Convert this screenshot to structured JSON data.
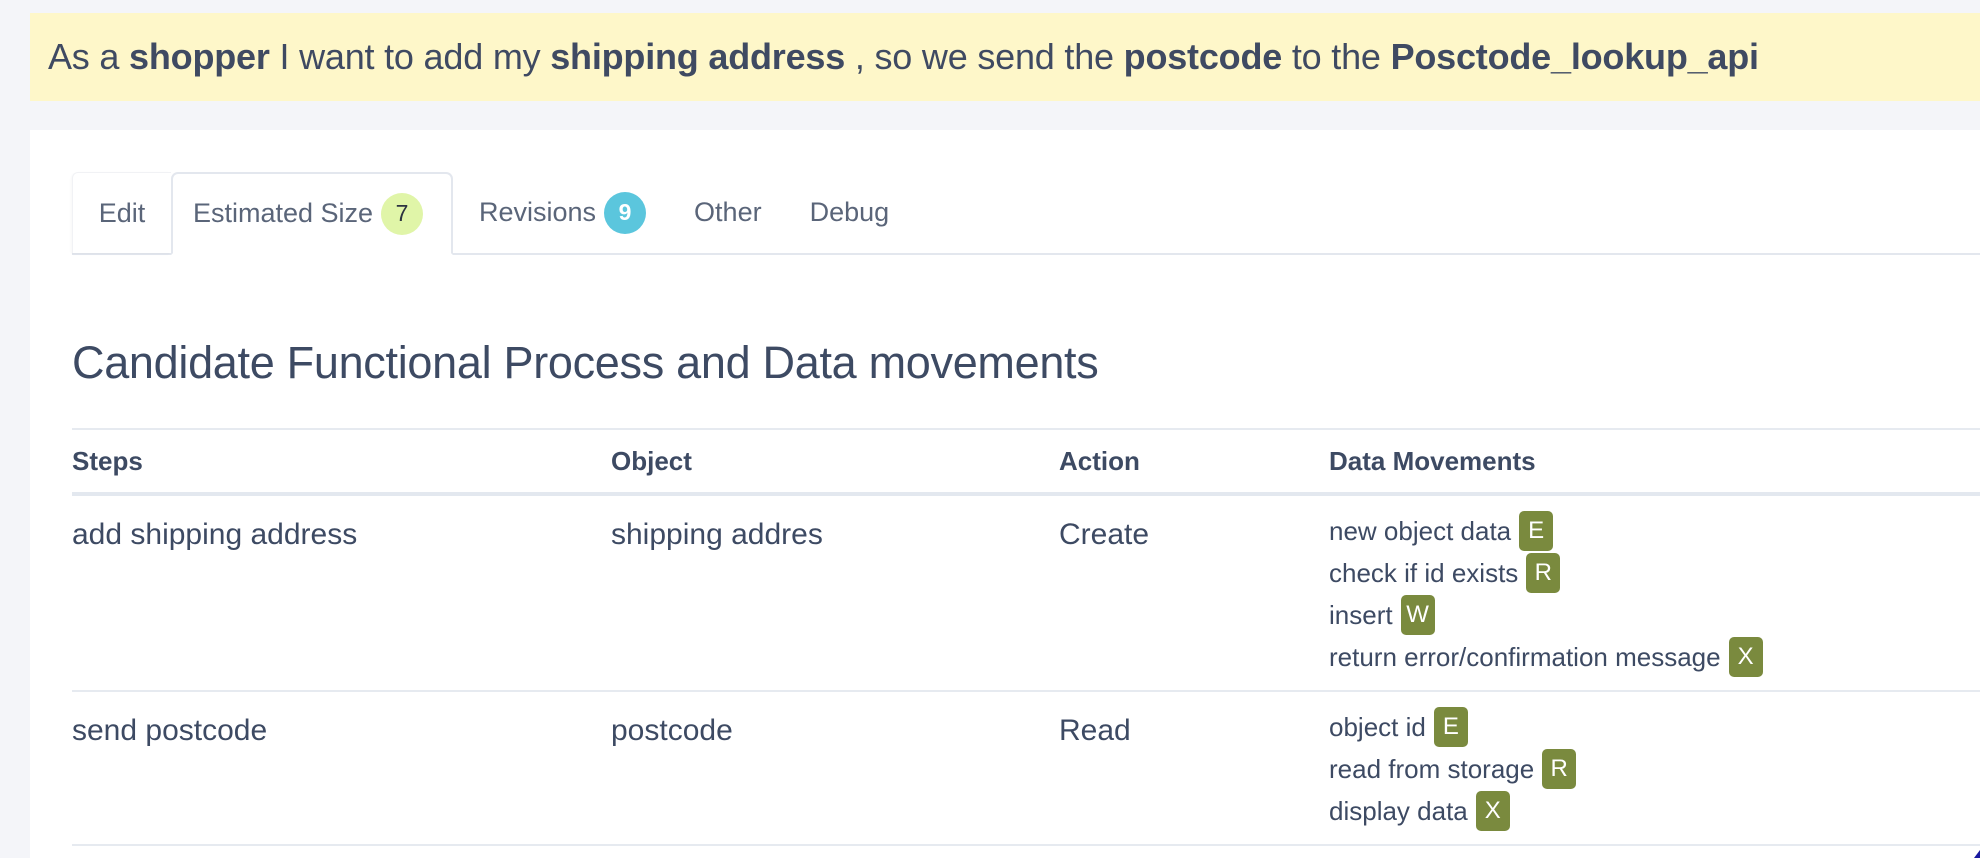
{
  "story": {
    "segments": [
      {
        "text": "As a ",
        "bold": false
      },
      {
        "text": "shopper",
        "bold": true
      },
      {
        "text": " I want to add my ",
        "bold": false
      },
      {
        "text": "shipping address",
        "bold": true
      },
      {
        "text": " , so we send the ",
        "bold": false
      },
      {
        "text": "postcode",
        "bold": true
      },
      {
        "text": " to the ",
        "bold": false
      },
      {
        "text": "Posctode_lookup_api",
        "bold": true
      }
    ]
  },
  "tabs": [
    {
      "label": "Edit",
      "active": false
    },
    {
      "label": "Estimated Size",
      "count": "7",
      "count_color": "#e0f5a8",
      "active": true
    },
    {
      "label": "Revisions",
      "count": "9",
      "count_color": "#5bc6dd",
      "active": false
    },
    {
      "label": "Other",
      "active": false
    },
    {
      "label": "Debug",
      "active": false
    }
  ],
  "section_title": "Candidate Functional Process and Data movements",
  "table": {
    "headers": [
      "Steps",
      "Object",
      "Action",
      "Data Movements"
    ],
    "rows": [
      {
        "step": "add shipping address",
        "object": "shipping addres",
        "action": "Create",
        "movements": [
          {
            "label": "new object data",
            "type": "E"
          },
          {
            "label": "check if id exists",
            "type": "R"
          },
          {
            "label": "insert",
            "type": "W"
          },
          {
            "label": "return error/confirmation message",
            "type": "X"
          }
        ]
      },
      {
        "step": "send postcode",
        "object": "postcode",
        "action": "Read",
        "movements": [
          {
            "label": "object id",
            "type": "E"
          },
          {
            "label": "read from storage",
            "type": "R"
          },
          {
            "label": "display data",
            "type": "X"
          }
        ]
      }
    ]
  },
  "colors": {
    "banner_bg": "#fef7c9",
    "page_bg": "#f4f5f9",
    "badge_bg": "#7a8a3e",
    "text": "#3d4a63"
  }
}
